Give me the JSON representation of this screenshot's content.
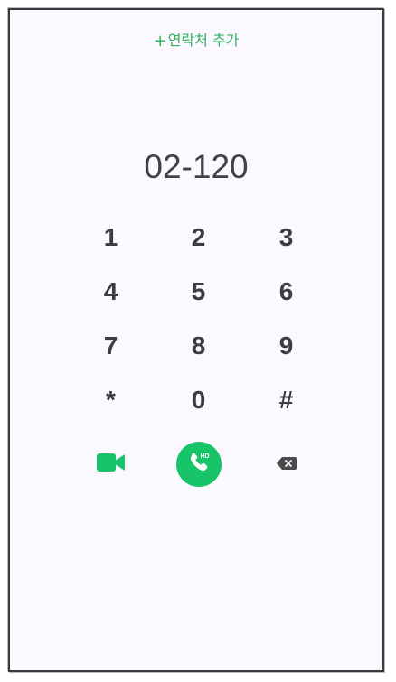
{
  "header": {
    "add_contact_plus": "+",
    "add_contact_label": "연락처 추가"
  },
  "dialer": {
    "number": "02-120"
  },
  "keypad": {
    "keys": [
      "1",
      "2",
      "3",
      "4",
      "5",
      "6",
      "7",
      "8",
      "9",
      "*",
      "0",
      "#"
    ]
  },
  "actions": {
    "video_icon": "video-camera-icon",
    "call_icon": "phone-hd-icon",
    "call_badge": "HD",
    "delete_icon": "backspace-icon"
  },
  "colors": {
    "accent": "#2db35b",
    "call_button": "#17c46a",
    "text": "#3d3d3d",
    "background": "#fcf8ff"
  }
}
